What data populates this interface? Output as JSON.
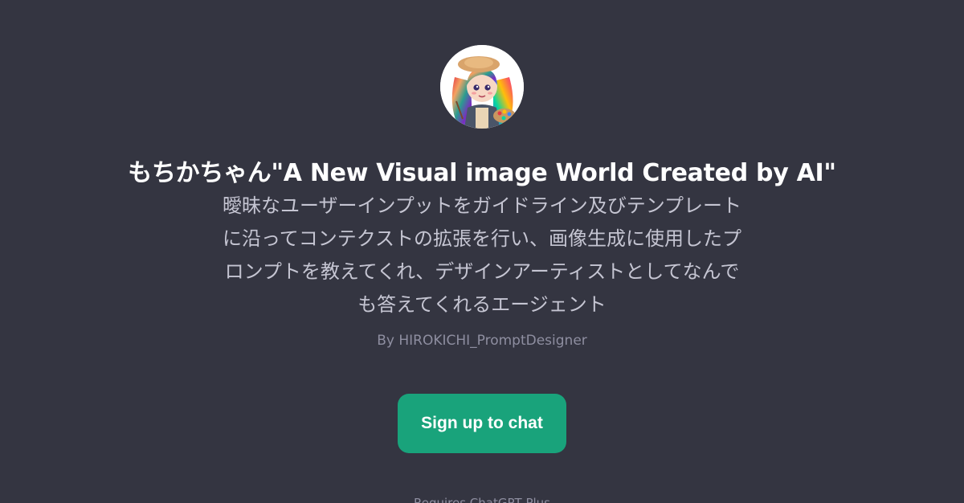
{
  "gpt": {
    "title": "もちかちゃん\"A New Visual image World Created by AI\"",
    "description": "曖昧なユーザーインプットをガイドライン及びテンプレートに沿ってコンテクストの拡張を行い、画像生成に使用したプロンプトを教えてくれ、デザインアーティストとしてなんでも答えてくれるエージェント",
    "author": "By HIROKICHI_PromptDesigner"
  },
  "cta": {
    "label": "Sign up to chat"
  },
  "footer": {
    "text": "Requires ChatGPT Plus"
  },
  "colors": {
    "background": "#343541",
    "accent": "#19a37b",
    "title": "#ffffff",
    "description": "#c5c5d2",
    "author": "#8e8ea0"
  },
  "icons": {
    "avatar": "character-avatar-icon"
  }
}
